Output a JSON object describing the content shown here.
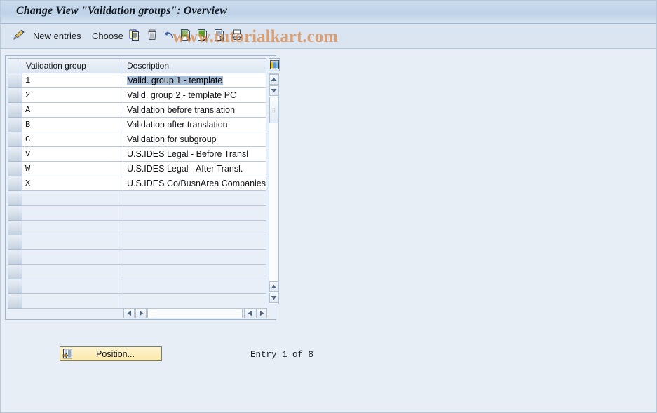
{
  "window": {
    "title": "Change View \"Validation groups\": Overview",
    "watermark": "www.tutorialkart.com"
  },
  "toolbar": {
    "items": [
      {
        "name": "display-change-icon",
        "icon": "pencil-change-icon",
        "label": ""
      },
      {
        "name": "new-entries-button",
        "icon": "",
        "label": "New entries"
      },
      {
        "name": "choose-button",
        "icon": "",
        "label": "Choose"
      },
      {
        "name": "copy-as-button",
        "icon": "copy-icon",
        "label": ""
      },
      {
        "name": "delete-button",
        "icon": "trash-icon",
        "label": ""
      },
      {
        "name": "undo-button",
        "icon": "undo-arrow-icon",
        "label": ""
      },
      {
        "name": "select-all-button",
        "icon": "document-green-select-icon",
        "label": ""
      },
      {
        "name": "select-block-button",
        "icon": "document-green-block-icon",
        "label": ""
      },
      {
        "name": "deselect-all-button",
        "icon": "document-lines-select-icon",
        "label": ""
      },
      {
        "name": "print-button",
        "icon": "printer-icon",
        "label": ""
      }
    ]
  },
  "table": {
    "columns": [
      {
        "key": "group",
        "label": "Validation group"
      },
      {
        "key": "description",
        "label": "Description"
      }
    ],
    "config_icon": "table-settings-icon",
    "selected_row_index": 0,
    "selected_cell": "description",
    "rows": [
      {
        "group": "1",
        "description": "Valid. group 1 - template"
      },
      {
        "group": "2",
        "description": "Valid. group 2 - template PC"
      },
      {
        "group": "A",
        "description": "Validation before translation"
      },
      {
        "group": "B",
        "description": "Validation after translation"
      },
      {
        "group": "C",
        "description": "Validation for subgroup"
      },
      {
        "group": "V",
        "description": "U.S.IDES Legal - Before Transl"
      },
      {
        "group": "W",
        "description": "U.S.IDES Legal - After Transl."
      },
      {
        "group": "X",
        "description": "U.S.IDES Co/BusnArea Companies"
      },
      {
        "group": "",
        "description": ""
      },
      {
        "group": "",
        "description": ""
      },
      {
        "group": "",
        "description": ""
      },
      {
        "group": "",
        "description": ""
      },
      {
        "group": "",
        "description": ""
      },
      {
        "group": "",
        "description": ""
      },
      {
        "group": "",
        "description": ""
      },
      {
        "group": "",
        "description": ""
      }
    ],
    "vscroll": {
      "up_icon": "scroll-up-arrow-icon",
      "down_icon": "scroll-down-arrow-icon",
      "thumb_icon": "scroll-thumb-grip-icon",
      "bottom_up_icon": "scroll-up-arrow-icon",
      "bottom_down_icon": "scroll-down-arrow-icon"
    },
    "hscroll": {
      "left_icon": "scroll-left-arrow-icon",
      "right_icon": "scroll-right-arrow-icon",
      "far_left_icon": "scroll-left-arrow-icon",
      "far_right_icon": "scroll-right-arrow-icon"
    }
  },
  "footer": {
    "position_button": {
      "label": "Position...",
      "icon": "position-jump-icon"
    },
    "entry_status": "Entry 1 of 8"
  },
  "colors": {
    "page_background": "#e8eef6",
    "titlebar": "#c4d5ea",
    "toolbar": "#dbe5f1",
    "grid_border": "#a9bdd2",
    "row_filled": "#ffffff",
    "row_empty": "#e9eff7",
    "selection_highlight": "#a9bdd4",
    "button_yellow": "#fbe9a8",
    "watermark": "#d98c50"
  }
}
